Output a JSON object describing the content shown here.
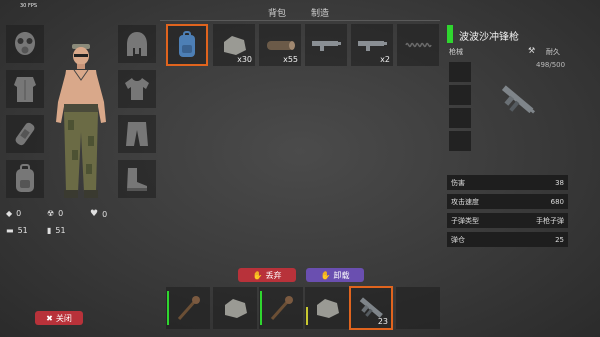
{
  "fps": "30 FPS",
  "tabs": [
    {
      "label": "背包"
    },
    {
      "label": "制造"
    }
  ],
  "stats": {
    "armor": "0",
    "radiation": "0",
    "health": "0",
    "food": "51",
    "water": "51"
  },
  "inventory": [
    {
      "icon": "backpack-icon",
      "qty": "",
      "selected": true
    },
    {
      "icon": "stone-icon",
      "qty": "x30"
    },
    {
      "icon": "log-icon",
      "qty": "x55"
    },
    {
      "icon": "gun-icon",
      "qty": ""
    },
    {
      "icon": "gun-icon",
      "qty": "x2"
    },
    {
      "icon": "spring-icon",
      "qty": ""
    }
  ],
  "item": {
    "name": "波波沙冲锋枪",
    "category": "枪械",
    "durability_label": "耐久",
    "durability_value": "498/500",
    "props": [
      {
        "label": "伤害",
        "value": "38"
      },
      {
        "label": "攻击速度",
        "value": "680"
      },
      {
        "label": "子弹类型",
        "value": "手枪子弹"
      },
      {
        "label": "弹仓",
        "value": "25"
      }
    ]
  },
  "buttons": {
    "drop": "丢弃",
    "unload": "卸载",
    "close": "关闭"
  },
  "hotbar": [
    {
      "icon": "torch-icon",
      "qty": ""
    },
    {
      "icon": "stone-icon",
      "qty": ""
    },
    {
      "icon": "torch-icon",
      "qty": ""
    },
    {
      "icon": "stone-icon",
      "qty": ""
    },
    {
      "icon": "gun-icon",
      "qty": "23",
      "selected": true
    },
    {
      "icon": "empty-slot",
      "qty": ""
    }
  ],
  "colors": {
    "accent": "#e0641e",
    "green": "#2fd62f",
    "drop": "#b8323a",
    "unload": "#6a4fb0",
    "close": "#b8323a"
  }
}
